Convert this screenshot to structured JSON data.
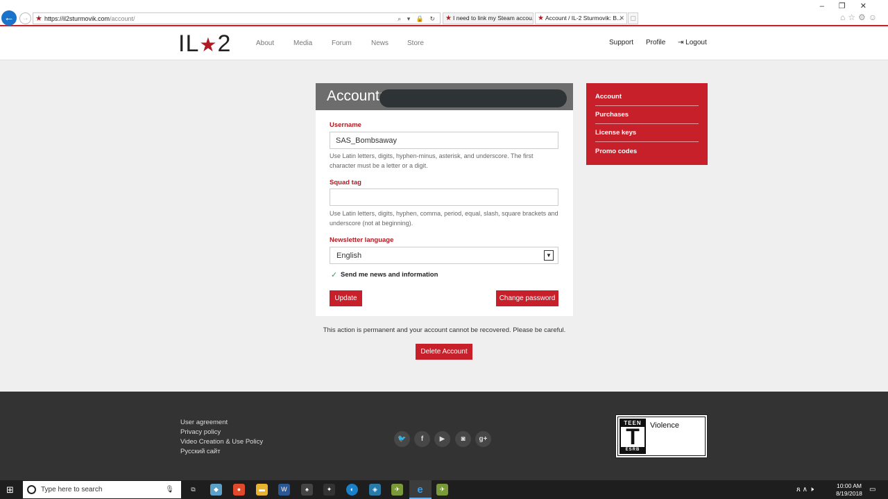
{
  "browser": {
    "url_host": "https://il2sturmovik.com",
    "url_path": "/account/",
    "addr_icons": "⌕ ▾ 🔒 ↻",
    "tabs": [
      {
        "title": "I need to link my Steam accou...",
        "active": false
      },
      {
        "title": "Account / IL-2 Sturmovik: B...",
        "active": true
      }
    ],
    "window_controls": "–❐✕",
    "right_icons": "⌂☆⚙☺"
  },
  "site": {
    "logo_left": "IL",
    "logo_star": "★",
    "logo_right": "2",
    "nav": [
      "About",
      "Media",
      "Forum",
      "News",
      "Store"
    ],
    "support_label": "Support",
    "profile_label": "Profile",
    "logout_icon": "⇥",
    "logout_label": "Logout"
  },
  "account_form": {
    "title": "Account:",
    "username_label": "Username",
    "username_value": "SAS_Bombsaway",
    "username_help": "Use Latin letters, digits, hyphen-minus, asterisk, and underscore. The first character must be a letter or a digit.",
    "squad_label": "Squad tag",
    "squad_value": "",
    "squad_help": "Use Latin letters, digits, hyphen, comma, period, equal, slash, square brackets and underscore (not at beginning).",
    "newsletter_label": "Newsletter language",
    "newsletter_value": "English",
    "checkbox_checked": true,
    "checkbox_label": "Send me news and information",
    "update_label": "Update",
    "change_password_label": "Change password",
    "warning": "This action is permanent and your account cannot be recovered. Please be careful.",
    "delete_label": "Delete Account"
  },
  "sidebar": {
    "items": [
      {
        "label": "Account"
      },
      {
        "label": "Purchases"
      },
      {
        "label": "License keys"
      },
      {
        "label": "Promo codes"
      }
    ]
  },
  "footer": {
    "links": [
      "User agreement",
      "Privacy policy",
      "Video Creation & Use Policy",
      "Русский сайт"
    ],
    "social": [
      "twitter-icon",
      "facebook-icon",
      "youtube-icon",
      "instagram-icon",
      "google-plus-icon"
    ],
    "social_glyphs": [
      "🐦",
      "f",
      "▶",
      "◙",
      "g+"
    ],
    "rating_top": "TEEN",
    "rating_letter": "T",
    "rating_bottom": "ESRB",
    "rating_desc": "Violence"
  },
  "taskbar": {
    "search_placeholder": "Type here to search",
    "time": "10:00 AM",
    "date": "8/19/2018",
    "tray_icons": "ጸ ∧ 🕨",
    "notification_icon": "▭"
  },
  "colors": {
    "brand_red": "#c8202a",
    "footer_bg": "#333333",
    "page_bg": "#efefef"
  }
}
